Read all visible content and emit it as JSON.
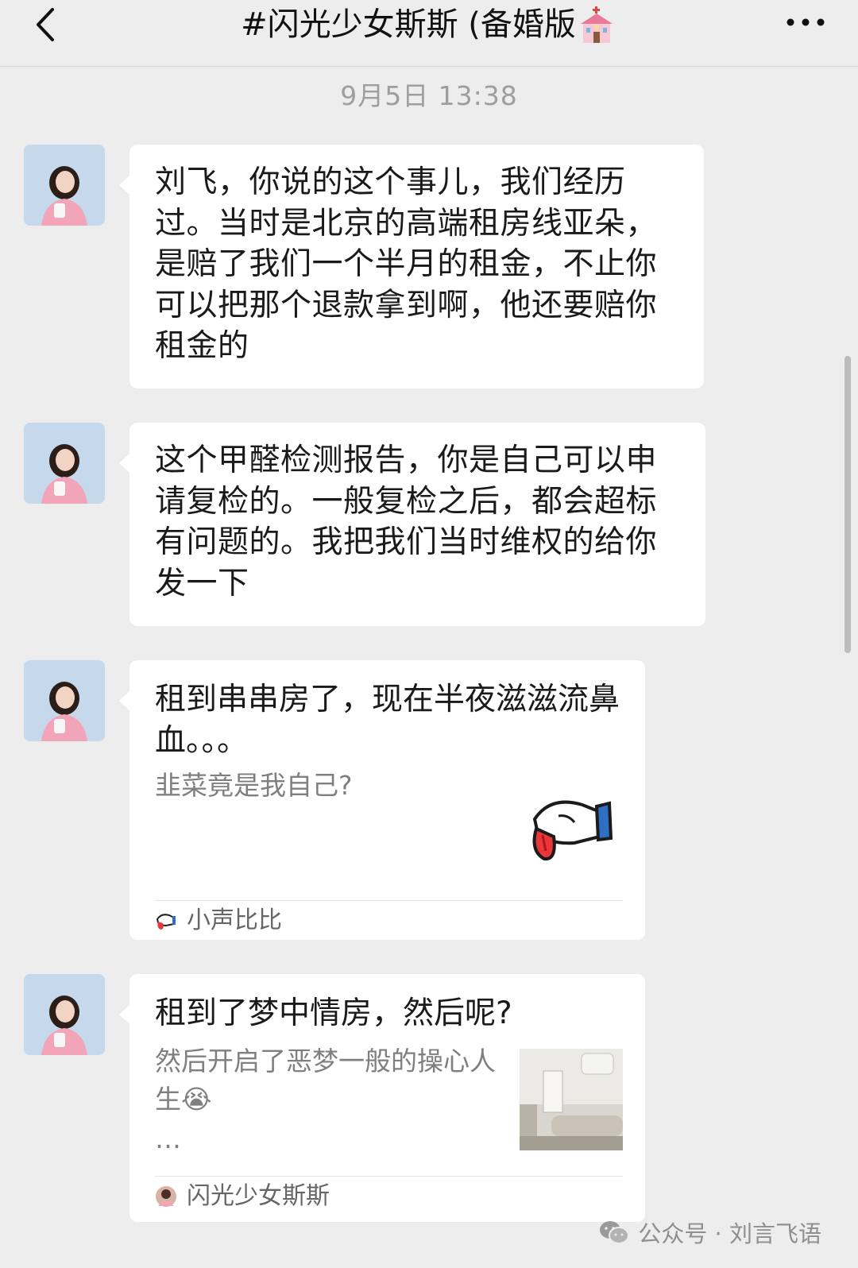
{
  "header": {
    "back_icon": "chevron-left-icon",
    "title": "#闪光少女斯斯 (备婚版",
    "title_emoji": "wedding-chapel-icon",
    "more_icon": "more-dots-icon"
  },
  "timestamp": "9月5日 13:38",
  "messages": [
    {
      "type": "text",
      "text": "刘飞，你说的这个事儿，我们经历过。当时是北京的高端租房线亚朵，是赔了我们一个半月的租金，不止你可以把那个退款拿到啊，他还要赔你租金的"
    },
    {
      "type": "text",
      "text": "这个甲醛检测报告，你是自己可以申请复检的。一般复检之后，都会超标有问题的。我把我们当时维权的给你发一下"
    },
    {
      "type": "article",
      "title": "租到串串房了，现在半夜滋滋流鼻血。。。",
      "description": "韭菜竟是我自己?",
      "source": "小声比比",
      "thumbnail": "tongue-cartoon-icon",
      "source_icon": "bibi-logo-icon"
    },
    {
      "type": "article",
      "title": "租到了梦中情房，然后呢?",
      "description": "然后开启了恶梦一般的操心人生😭",
      "ellipsis": "…",
      "source": "闪光少女斯斯",
      "thumbnail": "apartment-photo",
      "source_icon": "avatar-small-icon"
    }
  ],
  "watermark": {
    "icon": "wechat-icon",
    "text": "公众号 · 刘言飞语"
  },
  "colors": {
    "background": "#ededed",
    "bubble": "#ffffff",
    "secondary_text": "#7f7f7f",
    "timestamp": "#9e9e9e"
  }
}
